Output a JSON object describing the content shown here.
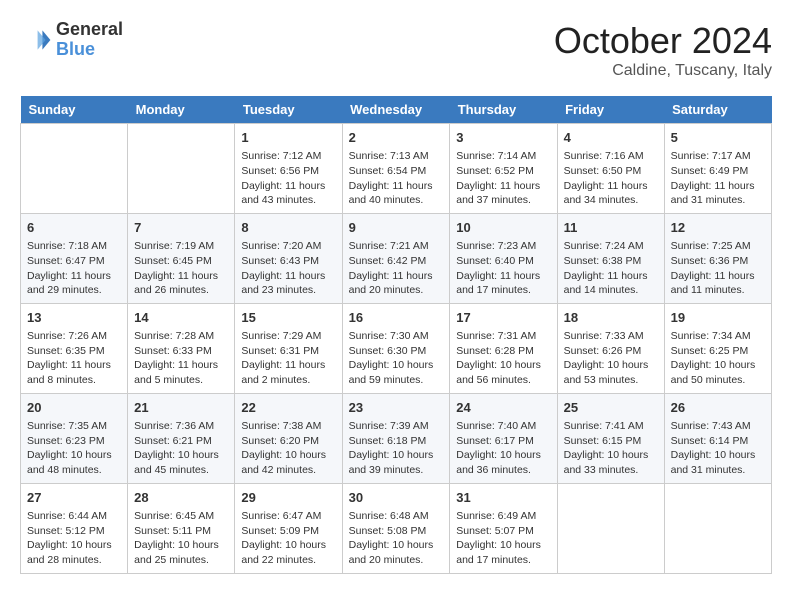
{
  "header": {
    "logo_text_general": "General",
    "logo_text_blue": "Blue",
    "month": "October 2024",
    "location": "Caldine, Tuscany, Italy"
  },
  "days_of_week": [
    "Sunday",
    "Monday",
    "Tuesday",
    "Wednesday",
    "Thursday",
    "Friday",
    "Saturday"
  ],
  "weeks": [
    [
      {
        "day": "",
        "info": ""
      },
      {
        "day": "",
        "info": ""
      },
      {
        "day": "1",
        "info": "Sunrise: 7:12 AM\nSunset: 6:56 PM\nDaylight: 11 hours and 43 minutes."
      },
      {
        "day": "2",
        "info": "Sunrise: 7:13 AM\nSunset: 6:54 PM\nDaylight: 11 hours and 40 minutes."
      },
      {
        "day": "3",
        "info": "Sunrise: 7:14 AM\nSunset: 6:52 PM\nDaylight: 11 hours and 37 minutes."
      },
      {
        "day": "4",
        "info": "Sunrise: 7:16 AM\nSunset: 6:50 PM\nDaylight: 11 hours and 34 minutes."
      },
      {
        "day": "5",
        "info": "Sunrise: 7:17 AM\nSunset: 6:49 PM\nDaylight: 11 hours and 31 minutes."
      }
    ],
    [
      {
        "day": "6",
        "info": "Sunrise: 7:18 AM\nSunset: 6:47 PM\nDaylight: 11 hours and 29 minutes."
      },
      {
        "day": "7",
        "info": "Sunrise: 7:19 AM\nSunset: 6:45 PM\nDaylight: 11 hours and 26 minutes."
      },
      {
        "day": "8",
        "info": "Sunrise: 7:20 AM\nSunset: 6:43 PM\nDaylight: 11 hours and 23 minutes."
      },
      {
        "day": "9",
        "info": "Sunrise: 7:21 AM\nSunset: 6:42 PM\nDaylight: 11 hours and 20 minutes."
      },
      {
        "day": "10",
        "info": "Sunrise: 7:23 AM\nSunset: 6:40 PM\nDaylight: 11 hours and 17 minutes."
      },
      {
        "day": "11",
        "info": "Sunrise: 7:24 AM\nSunset: 6:38 PM\nDaylight: 11 hours and 14 minutes."
      },
      {
        "day": "12",
        "info": "Sunrise: 7:25 AM\nSunset: 6:36 PM\nDaylight: 11 hours and 11 minutes."
      }
    ],
    [
      {
        "day": "13",
        "info": "Sunrise: 7:26 AM\nSunset: 6:35 PM\nDaylight: 11 hours and 8 minutes."
      },
      {
        "day": "14",
        "info": "Sunrise: 7:28 AM\nSunset: 6:33 PM\nDaylight: 11 hours and 5 minutes."
      },
      {
        "day": "15",
        "info": "Sunrise: 7:29 AM\nSunset: 6:31 PM\nDaylight: 11 hours and 2 minutes."
      },
      {
        "day": "16",
        "info": "Sunrise: 7:30 AM\nSunset: 6:30 PM\nDaylight: 10 hours and 59 minutes."
      },
      {
        "day": "17",
        "info": "Sunrise: 7:31 AM\nSunset: 6:28 PM\nDaylight: 10 hours and 56 minutes."
      },
      {
        "day": "18",
        "info": "Sunrise: 7:33 AM\nSunset: 6:26 PM\nDaylight: 10 hours and 53 minutes."
      },
      {
        "day": "19",
        "info": "Sunrise: 7:34 AM\nSunset: 6:25 PM\nDaylight: 10 hours and 50 minutes."
      }
    ],
    [
      {
        "day": "20",
        "info": "Sunrise: 7:35 AM\nSunset: 6:23 PM\nDaylight: 10 hours and 48 minutes."
      },
      {
        "day": "21",
        "info": "Sunrise: 7:36 AM\nSunset: 6:21 PM\nDaylight: 10 hours and 45 minutes."
      },
      {
        "day": "22",
        "info": "Sunrise: 7:38 AM\nSunset: 6:20 PM\nDaylight: 10 hours and 42 minutes."
      },
      {
        "day": "23",
        "info": "Sunrise: 7:39 AM\nSunset: 6:18 PM\nDaylight: 10 hours and 39 minutes."
      },
      {
        "day": "24",
        "info": "Sunrise: 7:40 AM\nSunset: 6:17 PM\nDaylight: 10 hours and 36 minutes."
      },
      {
        "day": "25",
        "info": "Sunrise: 7:41 AM\nSunset: 6:15 PM\nDaylight: 10 hours and 33 minutes."
      },
      {
        "day": "26",
        "info": "Sunrise: 7:43 AM\nSunset: 6:14 PM\nDaylight: 10 hours and 31 minutes."
      }
    ],
    [
      {
        "day": "27",
        "info": "Sunrise: 6:44 AM\nSunset: 5:12 PM\nDaylight: 10 hours and 28 minutes."
      },
      {
        "day": "28",
        "info": "Sunrise: 6:45 AM\nSunset: 5:11 PM\nDaylight: 10 hours and 25 minutes."
      },
      {
        "day": "29",
        "info": "Sunrise: 6:47 AM\nSunset: 5:09 PM\nDaylight: 10 hours and 22 minutes."
      },
      {
        "day": "30",
        "info": "Sunrise: 6:48 AM\nSunset: 5:08 PM\nDaylight: 10 hours and 20 minutes."
      },
      {
        "day": "31",
        "info": "Sunrise: 6:49 AM\nSunset: 5:07 PM\nDaylight: 10 hours and 17 minutes."
      },
      {
        "day": "",
        "info": ""
      },
      {
        "day": "",
        "info": ""
      }
    ]
  ]
}
